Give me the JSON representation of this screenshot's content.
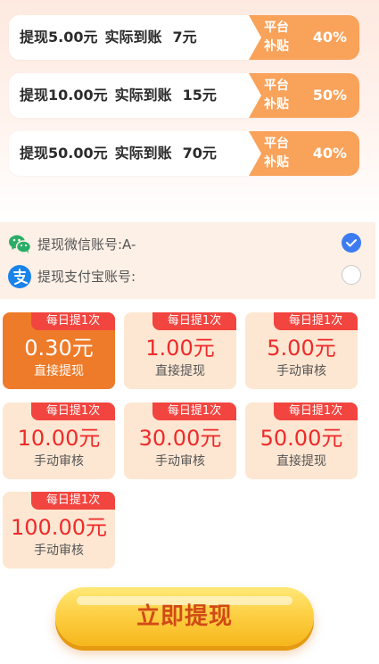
{
  "promos": [
    {
      "withdraw": "提现5.00元",
      "actual_label": "实际到账",
      "amount": "7元",
      "badge_line1": "平台",
      "badge_line2": "补贴",
      "badge_pct": "40%"
    },
    {
      "withdraw": "提现10.00元",
      "actual_label": "实际到账",
      "amount": "15元",
      "badge_line1": "平台",
      "badge_line2": "补贴",
      "badge_pct": "50%"
    },
    {
      "withdraw": "提现50.00元",
      "actual_label": "实际到账",
      "amount": "70元",
      "badge_line1": "平台",
      "badge_line2": "补贴",
      "badge_pct": "40%"
    }
  ],
  "payment": {
    "wechat": {
      "label": "提现微信账号:A-",
      "icon": "wechat-icon",
      "selected": true
    },
    "alipay": {
      "label": "提现支付宝账号:",
      "icon": "alipay-icon",
      "selected": false
    }
  },
  "amounts": [
    {
      "tag": "每日提1次",
      "amount": "0.30元",
      "desc": "直接提现",
      "selected": true
    },
    {
      "tag": "每日提1次",
      "amount": "1.00元",
      "desc": "直接提现",
      "selected": false
    },
    {
      "tag": "每日提1次",
      "amount": "5.00元",
      "desc": "手动审核",
      "selected": false
    },
    {
      "tag": "每日提1次",
      "amount": "10.00元",
      "desc": "手动审核",
      "selected": false
    },
    {
      "tag": "每日提1次",
      "amount": "30.00元",
      "desc": "手动审核",
      "selected": false
    },
    {
      "tag": "每日提1次",
      "amount": "50.00元",
      "desc": "直接提现",
      "selected": false
    },
    {
      "tag": "每日提1次",
      "amount": "100.00元",
      "desc": "手动审核",
      "selected": false
    }
  ],
  "submit": {
    "label": "立即提现"
  },
  "colors": {
    "accent": "#ee7b29",
    "badge": "#f9a25a",
    "tag": "#f2453f",
    "radio_on": "#3d7bf2",
    "amount_text": "#ef2a2a"
  }
}
